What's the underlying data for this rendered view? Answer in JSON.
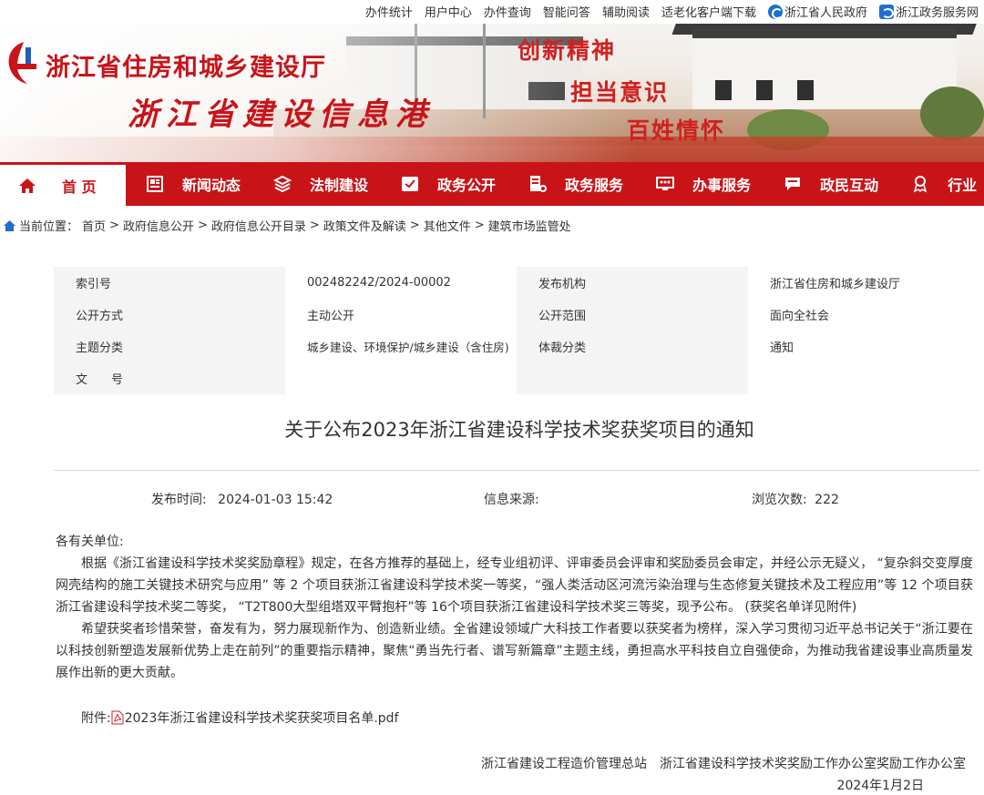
{
  "top_links": [
    "办件统计",
    "用户中心",
    "办件查询",
    "智能问答",
    "辅助阅读",
    "适老化客户端下载"
  ],
  "top_icon_links": [
    {
      "label": "浙江省人民政府",
      "icon": "gov-logo-icon"
    },
    {
      "label": "浙江政务服务网",
      "icon": "service-logo-icon"
    }
  ],
  "banner": {
    "org_name": "浙江省住房和城乡建设厅",
    "site_name": "浙江省建设信息港",
    "slogans": [
      "创新精神",
      "担当意识",
      "百姓情怀"
    ]
  },
  "nav": [
    {
      "label": "首 页",
      "icon": "home-icon"
    },
    {
      "label": "新闻动态",
      "icon": "news-icon"
    },
    {
      "label": "法制建设",
      "icon": "law-icon"
    },
    {
      "label": "政务公开",
      "icon": "disclosure-icon"
    },
    {
      "label": "政务服务",
      "icon": "service-icon"
    },
    {
      "label": "办事服务",
      "icon": "affairs-icon"
    },
    {
      "label": "政民互动",
      "icon": "interaction-icon"
    },
    {
      "label": "行业",
      "icon": "industry-icon"
    }
  ],
  "breadcrumb": {
    "label": "当前位置：",
    "items": [
      "首页",
      "政府信息公开",
      "政府信息公开目录",
      "政策文件及解读",
      "其他文件",
      "建筑市场监管处"
    ],
    "separator": ">"
  },
  "info_table": [
    [
      "索引号",
      "002482242/2024-00002",
      "发布机构",
      "浙江省住房和城乡建设厅"
    ],
    [
      "公开方式",
      "主动公开",
      "公开范围",
      "面向全社会"
    ],
    [
      "主题分类",
      "城乡建设、环境保护/城乡建设（含住房)",
      "体裁分类",
      "通知"
    ],
    [
      "文　　号",
      "",
      "",
      ""
    ]
  ],
  "article": {
    "title": "关于公布2023年浙江省建设科学技术奖获奖项目的通知",
    "publish_label": "发布时间:",
    "publish_time": "2024-01-03 15:42",
    "source_label": "信息来源:",
    "source_value": "",
    "views_label": "浏览次数:",
    "views": "222",
    "salutation": "各有关单位:",
    "paragraph_1": "根据《浙江省建设科学技术奖奖励章程》规定，在各方推荐的基础上，经专业组初评、评审委员会评审和奖励委员会审定，并经公示无疑义， “复杂斜交变厚度网壳结构的施工关键技术研究与应用” 等 2 个项目获浙江省建设科学技术奖一等奖，“强人类活动区河流污染治理与生态修复关键技术及工程应用”等 12 个项目获浙江省建设科学技术奖二等奖， “T2T800大型组塔双平臂抱杆”等 16个项目获浙江省建设科学技术奖三等奖，现予公布。 (获奖名单详见附件)",
    "paragraph_2": "希望获奖者珍惜荣誉，奋发有为，努力展现新作为、创造新业绩。全省建设领域广大科技工作者要以获奖者为榜样，深入学习贯彻习近平总书记关于“浙江要在以科技创新塑造发展新优势上走在前列”的重要指示精神，聚焦“勇当先行者、谱写新篇章”主题主线，勇担高水平科技自立自强使命，为推动我省建设事业高质量发展作出新的更大贡献。",
    "attachment_label": "附件:",
    "attachment_file": "2023年浙江省建设科学技术奖获奖项目名单.pdf",
    "signature": "浙江省建设工程造价管理总站　浙江省建设科学技术奖奖励工作办公室奖励工作办公室",
    "date": "2024年1月2日"
  }
}
